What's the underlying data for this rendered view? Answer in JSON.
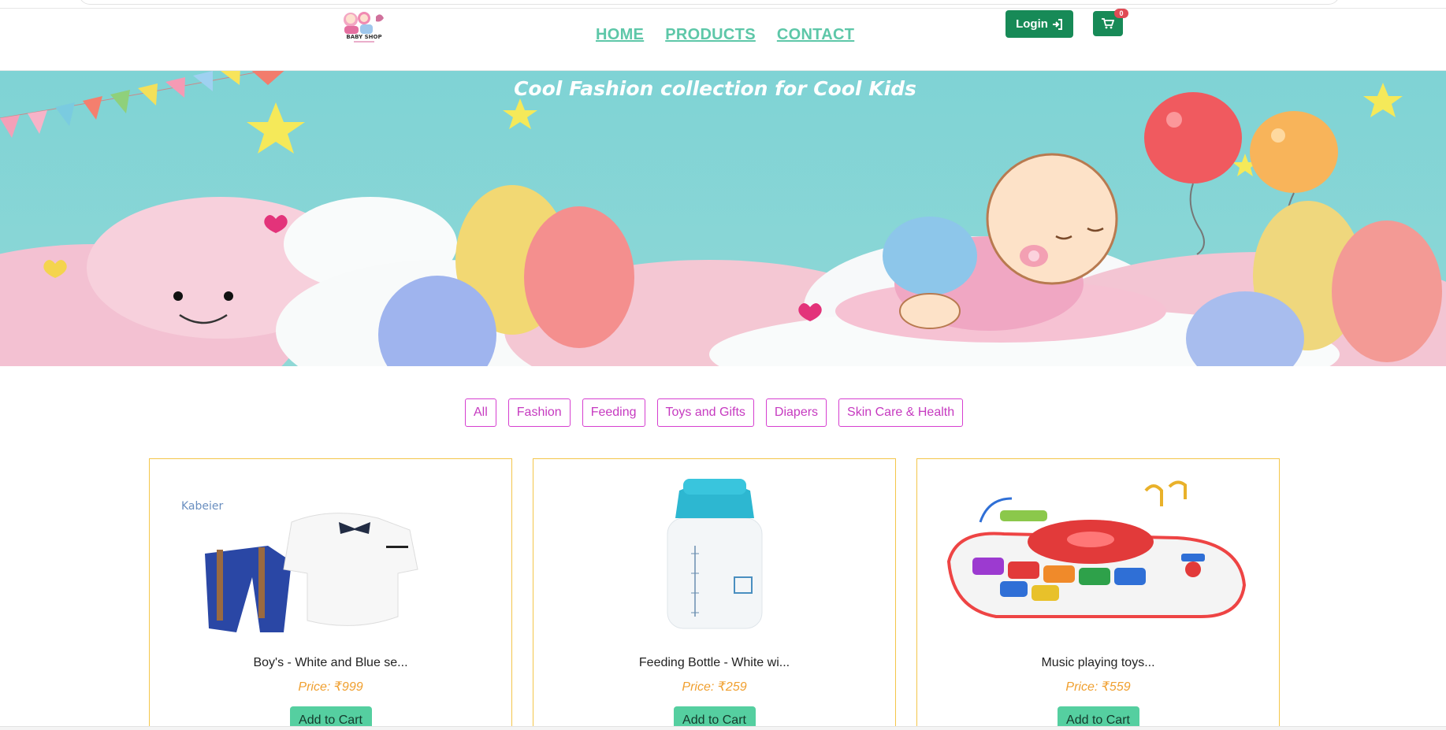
{
  "header": {
    "logo_text": "BABY SHOP",
    "nav": [
      "HOME",
      "PRODUCTS",
      "CONTACT"
    ],
    "login_label": "Login",
    "cart_count": "0"
  },
  "banner": {
    "title": "Cool Fashion collection for Cool Kids"
  },
  "filters": [
    "All",
    "Fashion",
    "Feeding",
    "Toys and Gifts",
    "Diapers",
    "Skin Care & Health"
  ],
  "products": [
    {
      "name": "Boy's - White and Blue se...",
      "price": "Price: ₹999",
      "button": "Add to Cart",
      "image": "boys-outfit-image"
    },
    {
      "name": "Feeding Bottle - White wi...",
      "price": "Price: ₹259",
      "button": "Add to Cart",
      "image": "feeding-bottle-image"
    },
    {
      "name": "Music playing toys...",
      "price": "Price: ₹559",
      "button": "Add to Cart",
      "image": "music-toy-image"
    }
  ],
  "colors": {
    "nav_link": "#5dc7a8",
    "primary_button": "#178a57",
    "filter_border": "#d63fd0",
    "card_border": "#f4c64a",
    "price": "#f0a030",
    "add_button": "#55cfa0",
    "banner_bg": "#7fd2d5"
  }
}
